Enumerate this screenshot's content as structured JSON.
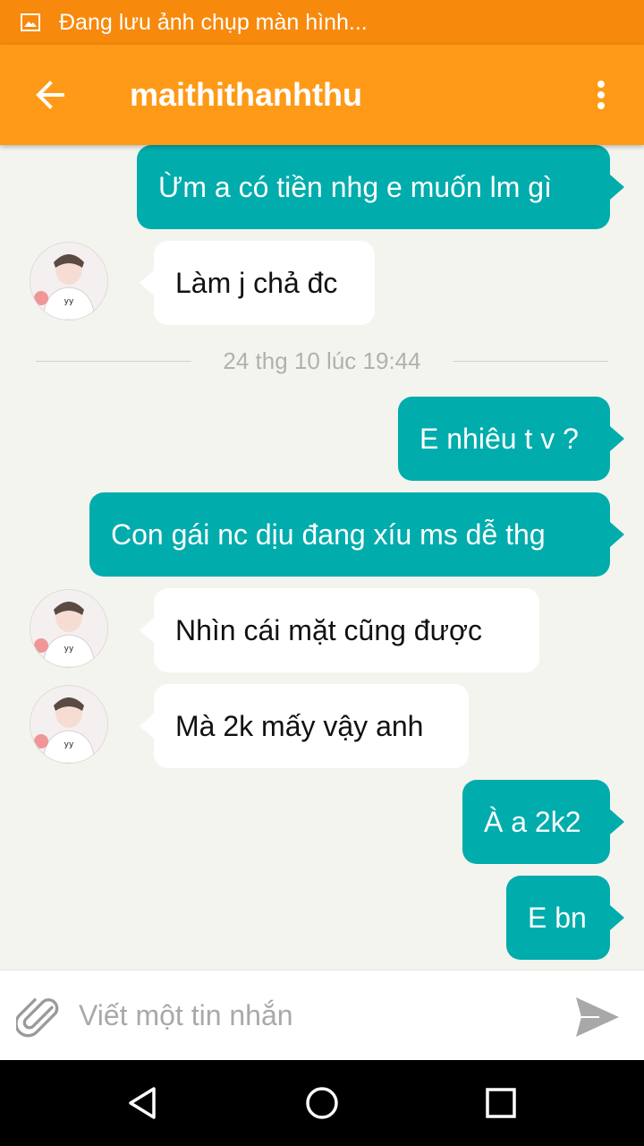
{
  "status_bar": {
    "text": "Đang lưu ảnh chụp màn hình...",
    "icon": "image-icon"
  },
  "header": {
    "title": "maithithanhthu",
    "back_icon": "arrow-left-icon",
    "menu_icon": "more-vert-icon"
  },
  "colors": {
    "status_bar": "#f7890c",
    "app_bar": "#fe9a17",
    "outgoing_bubble": "#00acac",
    "incoming_bubble": "#ffffff",
    "background": "#f4f4ef"
  },
  "messages": [
    {
      "direction": "outgoing",
      "text": "Ừm a có tiền nhg e muốn lm gì"
    },
    {
      "direction": "incoming",
      "text": "Làm j chả đc"
    },
    {
      "direction": "outgoing",
      "text": "E nhiêu t v ?"
    },
    {
      "direction": "outgoing",
      "text": "Con gái nc dịu đang xíu ms dễ thg"
    },
    {
      "direction": "incoming",
      "text": "Nhìn cái mặt cũng được"
    },
    {
      "direction": "incoming",
      "text": "Mà 2k mấy vậy anh"
    },
    {
      "direction": "outgoing",
      "text": "À a 2k2"
    },
    {
      "direction": "outgoing",
      "text": "E bn"
    }
  ],
  "timestamp": "24 thg 10 lúc 19:44",
  "composer": {
    "placeholder": "Viết một tin nhắn",
    "attach_icon": "paperclip-icon",
    "send_icon": "send-icon"
  },
  "nav": {
    "back": "nav-back-icon",
    "home": "nav-home-icon",
    "recents": "nav-recents-icon"
  }
}
